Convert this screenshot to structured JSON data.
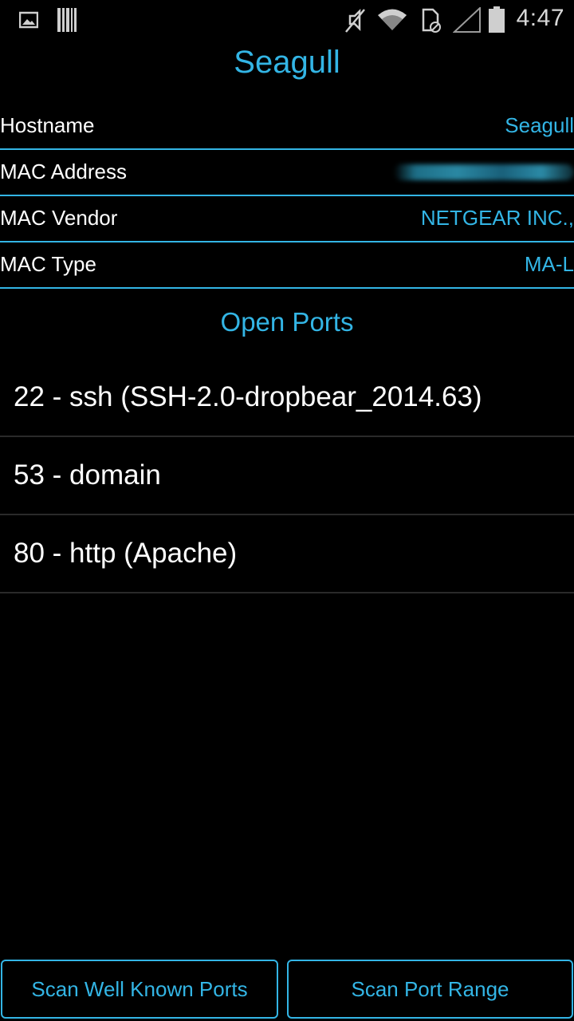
{
  "status_bar": {
    "time": "4:47",
    "icons": [
      "image-icon",
      "barcode-icon",
      "mute-icon",
      "wifi-icon",
      "sim-icon",
      "signal-icon",
      "battery-icon"
    ]
  },
  "device": {
    "title": "Seagull"
  },
  "info": [
    {
      "label": "Hostname",
      "value": "Seagull"
    },
    {
      "label": "MAC Address",
      "value": ""
    },
    {
      "label": "MAC Vendor",
      "value": "NETGEAR INC.,"
    },
    {
      "label": "MAC Type",
      "value": "MA-L"
    }
  ],
  "ports": {
    "heading": "Open Ports",
    "items": [
      "22 - ssh (SSH-2.0-dropbear_2014.63)",
      "53 - domain",
      "80 - http (Apache)"
    ]
  },
  "buttons": {
    "scan_well_known": "Scan Well Known Ports",
    "scan_range": "Scan Port Range"
  },
  "colors": {
    "accent": "#33b5e5",
    "background": "#000000",
    "text": "#ffffff",
    "divider": "#2a2a2a"
  }
}
